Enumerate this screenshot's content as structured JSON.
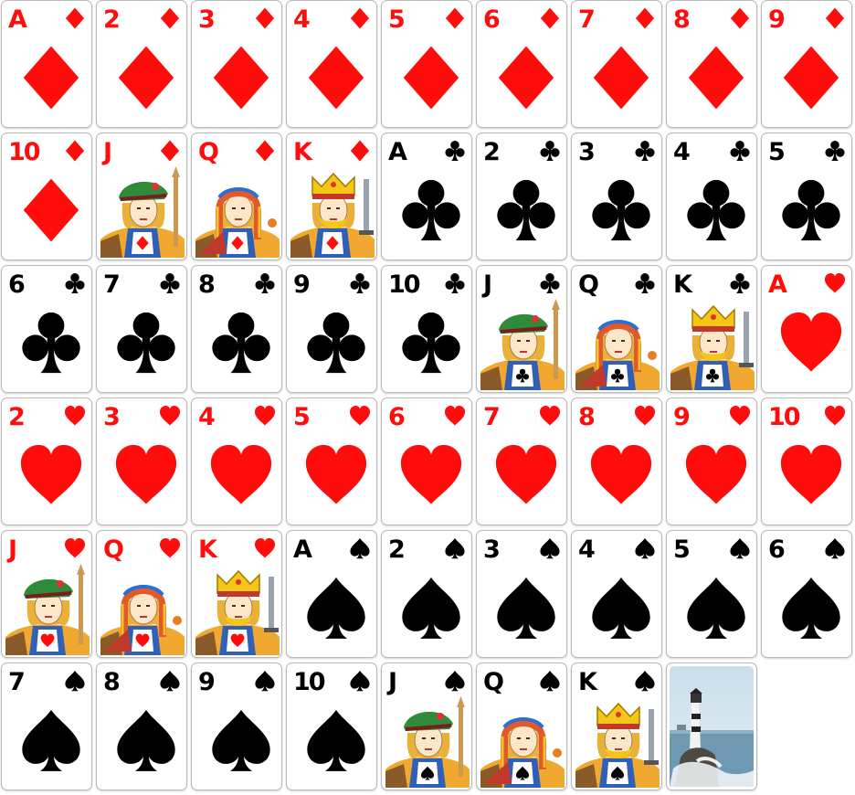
{
  "layout": "grid",
  "colors": {
    "red": "#ff0d0d",
    "black": "#000000",
    "card_back_sky": "#cfe3ef",
    "card_back_sea": "#4a7fa0"
  },
  "cards": [
    {
      "rank": "A",
      "suit": "diamonds",
      "color": "red"
    },
    {
      "rank": "2",
      "suit": "diamonds",
      "color": "red"
    },
    {
      "rank": "3",
      "suit": "diamonds",
      "color": "red"
    },
    {
      "rank": "4",
      "suit": "diamonds",
      "color": "red"
    },
    {
      "rank": "5",
      "suit": "diamonds",
      "color": "red"
    },
    {
      "rank": "6",
      "suit": "diamonds",
      "color": "red"
    },
    {
      "rank": "7",
      "suit": "diamonds",
      "color": "red"
    },
    {
      "rank": "8",
      "suit": "diamonds",
      "color": "red"
    },
    {
      "rank": "9",
      "suit": "diamonds",
      "color": "red"
    },
    {
      "rank": "10",
      "suit": "diamonds",
      "color": "red"
    },
    {
      "rank": "J",
      "suit": "diamonds",
      "color": "red",
      "face": "jack"
    },
    {
      "rank": "Q",
      "suit": "diamonds",
      "color": "red",
      "face": "queen"
    },
    {
      "rank": "K",
      "suit": "diamonds",
      "color": "red",
      "face": "king"
    },
    {
      "rank": "A",
      "suit": "clubs",
      "color": "black"
    },
    {
      "rank": "2",
      "suit": "clubs",
      "color": "black"
    },
    {
      "rank": "3",
      "suit": "clubs",
      "color": "black"
    },
    {
      "rank": "4",
      "suit": "clubs",
      "color": "black"
    },
    {
      "rank": "5",
      "suit": "clubs",
      "color": "black"
    },
    {
      "rank": "6",
      "suit": "clubs",
      "color": "black"
    },
    {
      "rank": "7",
      "suit": "clubs",
      "color": "black"
    },
    {
      "rank": "8",
      "suit": "clubs",
      "color": "black"
    },
    {
      "rank": "9",
      "suit": "clubs",
      "color": "black"
    },
    {
      "rank": "10",
      "suit": "clubs",
      "color": "black"
    },
    {
      "rank": "J",
      "suit": "clubs",
      "color": "black",
      "face": "jack"
    },
    {
      "rank": "Q",
      "suit": "clubs",
      "color": "black",
      "face": "queen"
    },
    {
      "rank": "K",
      "suit": "clubs",
      "color": "black",
      "face": "king"
    },
    {
      "rank": "A",
      "suit": "hearts",
      "color": "red"
    },
    {
      "rank": "2",
      "suit": "hearts",
      "color": "red"
    },
    {
      "rank": "3",
      "suit": "hearts",
      "color": "red"
    },
    {
      "rank": "4",
      "suit": "hearts",
      "color": "red"
    },
    {
      "rank": "5",
      "suit": "hearts",
      "color": "red"
    },
    {
      "rank": "6",
      "suit": "hearts",
      "color": "red"
    },
    {
      "rank": "7",
      "suit": "hearts",
      "color": "red"
    },
    {
      "rank": "8",
      "suit": "hearts",
      "color": "red"
    },
    {
      "rank": "9",
      "suit": "hearts",
      "color": "red"
    },
    {
      "rank": "10",
      "suit": "hearts",
      "color": "red"
    },
    {
      "rank": "J",
      "suit": "hearts",
      "color": "red",
      "face": "jack"
    },
    {
      "rank": "Q",
      "suit": "hearts",
      "color": "red",
      "face": "queen"
    },
    {
      "rank": "K",
      "suit": "hearts",
      "color": "red",
      "face": "king"
    },
    {
      "rank": "A",
      "suit": "spades",
      "color": "black"
    },
    {
      "rank": "2",
      "suit": "spades",
      "color": "black"
    },
    {
      "rank": "3",
      "suit": "spades",
      "color": "black"
    },
    {
      "rank": "4",
      "suit": "spades",
      "color": "black"
    },
    {
      "rank": "5",
      "suit": "spades",
      "color": "black"
    },
    {
      "rank": "6",
      "suit": "spades",
      "color": "black"
    },
    {
      "rank": "7",
      "suit": "spades",
      "color": "black"
    },
    {
      "rank": "8",
      "suit": "spades",
      "color": "black"
    },
    {
      "rank": "9",
      "suit": "spades",
      "color": "black"
    },
    {
      "rank": "10",
      "suit": "spades",
      "color": "black"
    },
    {
      "rank": "J",
      "suit": "spades",
      "color": "black",
      "face": "jack"
    },
    {
      "rank": "Q",
      "suit": "spades",
      "color": "black",
      "face": "queen"
    },
    {
      "rank": "K",
      "suit": "spades",
      "color": "black",
      "face": "king"
    }
  ],
  "card_back": {
    "image": "lighthouse-photo"
  }
}
